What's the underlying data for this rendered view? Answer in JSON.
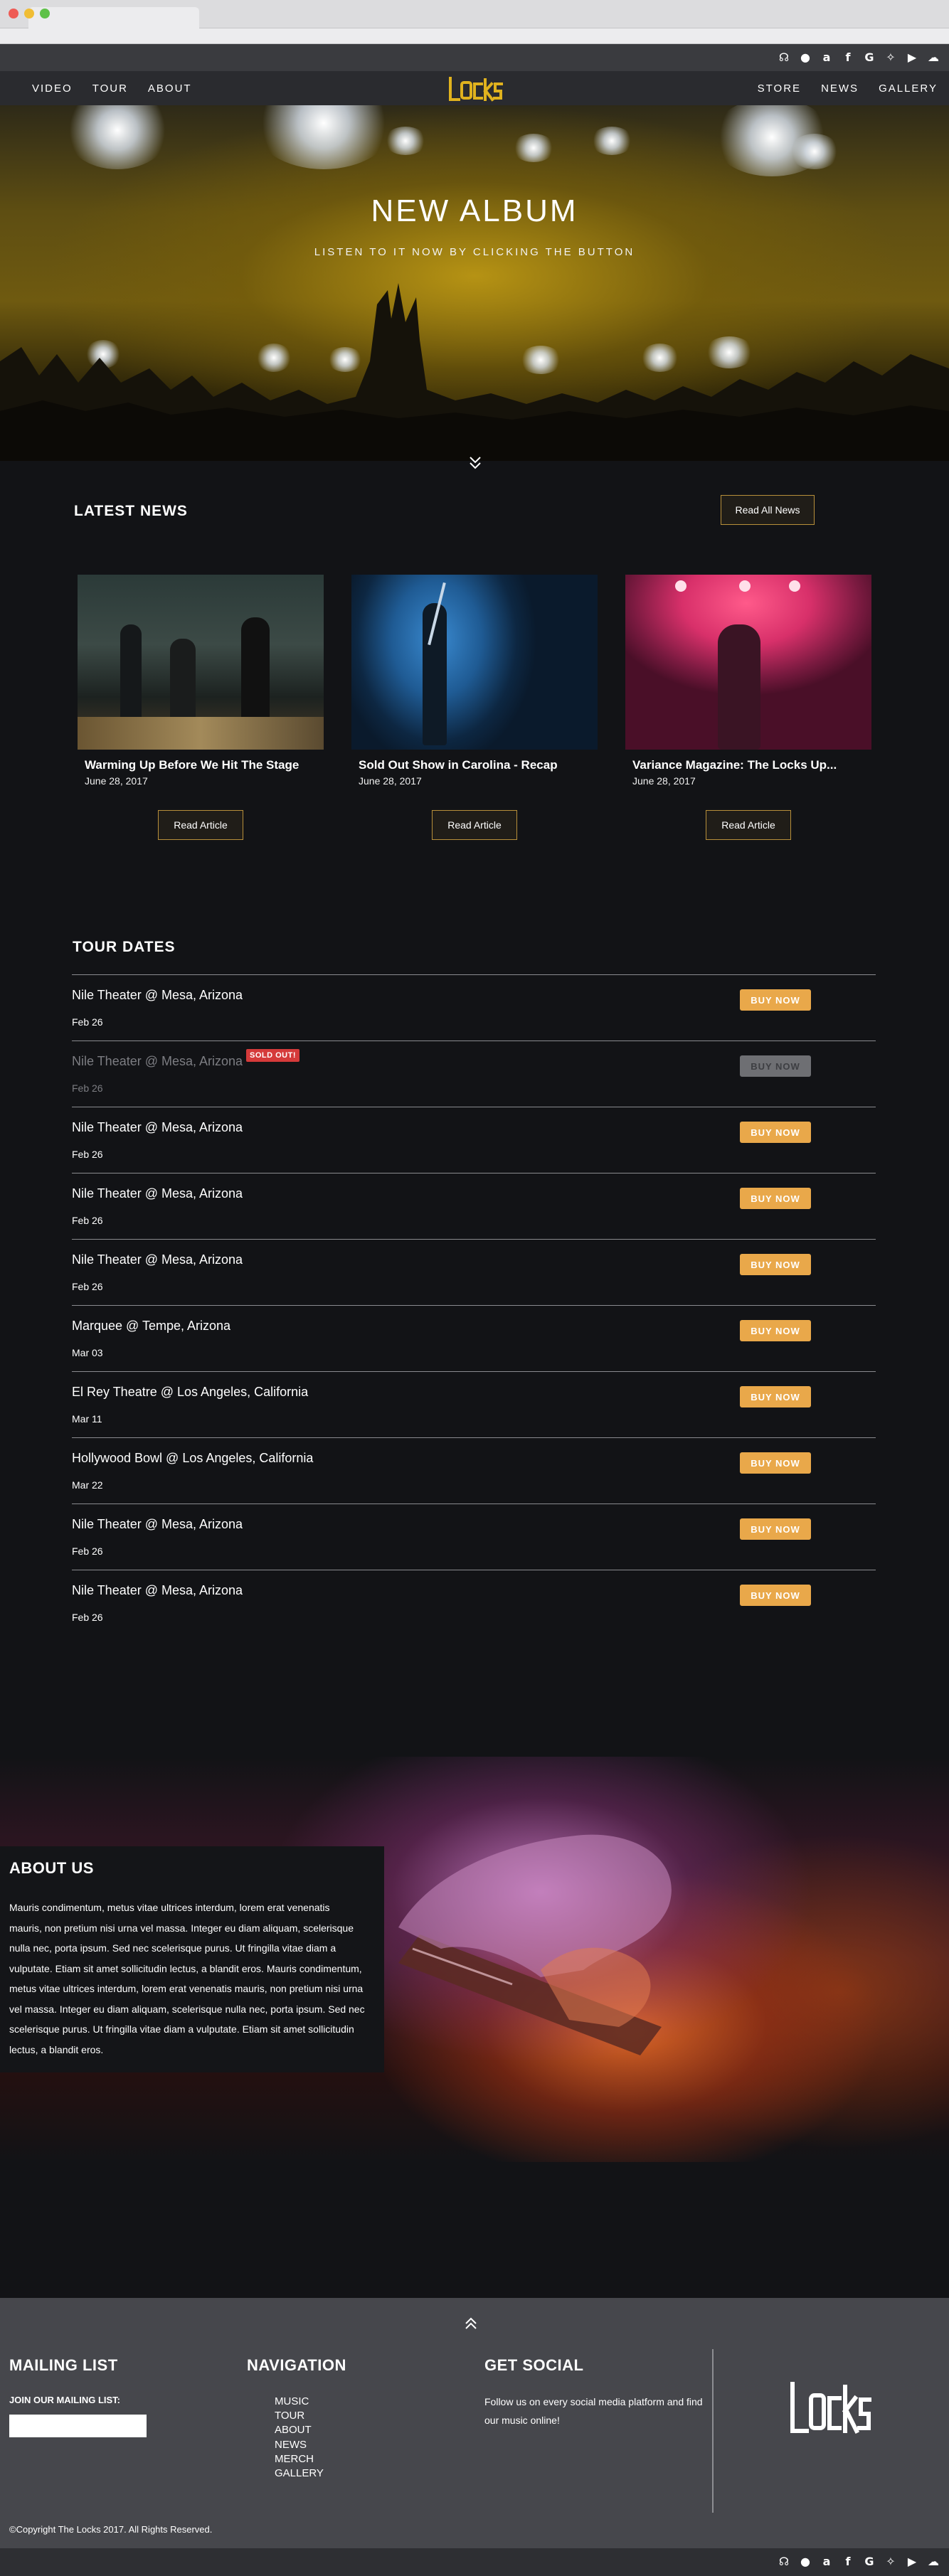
{
  "social_icons": [
    "headphones-icon",
    "apple-icon",
    "amazon-icon",
    "facebook-icon",
    "google-icon",
    "twitter-icon",
    "youtube-icon",
    "soundcloud-icon"
  ],
  "social_glyphs": [
    "☊",
    "●",
    "a",
    "f",
    "G",
    "✧",
    "▶",
    "☁"
  ],
  "nav": {
    "left": [
      "VIDEO",
      "TOUR",
      "ABOUT"
    ],
    "right": [
      "STORE",
      "NEWS",
      "GALLERY"
    ]
  },
  "hero": {
    "title": "NEW ALBUM",
    "subtitle": "LISTEN TO IT NOW BY CLICKING THE BUTTON"
  },
  "news": {
    "title": "LATEST NEWS",
    "read_all_label": "Read All News",
    "read_article_label": "Read Article",
    "articles": [
      {
        "title": "Warming Up Before We Hit The Stage",
        "date": "June 28, 2017"
      },
      {
        "title": "Sold Out Show in Carolina - Recap",
        "date": "June 28, 2017"
      },
      {
        "title": "Variance Magazine: The Locks Up...",
        "date": "June 28, 2017"
      }
    ]
  },
  "tour": {
    "title": "TOUR DATES",
    "buy_label": "BUY NOW",
    "sold_out_label": "SOLD OUT!",
    "dates": [
      {
        "venue": "Nile Theater @ Mesa, Arizona",
        "date": "Feb 26"
      },
      {
        "venue": "Nile Theater @ Mesa, Arizona",
        "date": "Feb 26",
        "sold_out": true
      },
      {
        "venue": "Nile Theater @ Mesa, Arizona",
        "date": "Feb 26"
      },
      {
        "venue": "Nile Theater @ Mesa, Arizona",
        "date": "Feb 26"
      },
      {
        "venue": "Nile Theater @ Mesa, Arizona",
        "date": "Feb 26"
      },
      {
        "venue": "Marquee @ Tempe, Arizona",
        "date": "Mar 03"
      },
      {
        "venue": "El Rey Theatre @ Los Angeles, California",
        "date": "Mar 11"
      },
      {
        "venue": "Hollywood Bowl @ Los Angeles, California",
        "date": "Mar 22"
      },
      {
        "venue": "Nile Theater @ Mesa, Arizona",
        "date": "Feb 26"
      },
      {
        "venue": "Nile Theater @ Mesa, Arizona",
        "date": "Feb 26"
      }
    ]
  },
  "about": {
    "title": "ABOUT US",
    "body": "Mauris condimentum, metus vitae ultrices interdum, lorem erat venenatis mauris, non pretium nisi urna vel massa. Integer eu diam aliquam, scelerisque nulla nec, porta ipsum. Sed nec scelerisque purus. Ut fringilla vitae diam a vulputate. Etiam sit amet sollicitudin lectus, a blandit eros. Mauris condimentum, metus vitae ultrices interdum, lorem erat venenatis mauris, non pretium nisi urna vel massa. Integer eu diam aliquam, scelerisque nulla nec, porta ipsum. Sed nec scelerisque purus. Ut fringilla vitae diam a vulputate. Etiam sit amet sollicitudin lectus, a blandit eros."
  },
  "footer": {
    "mailing_title": "MAILING LIST",
    "mailing_label": "JOIN OUR MAILING LIST:",
    "mailing_placeholder": "",
    "nav_title": "NAVIGATION",
    "nav_items": [
      "MUSIC",
      "TOUR",
      "ABOUT",
      "NEWS",
      "MERCH",
      "GALLERY"
    ],
    "social_title": "GET SOCIAL",
    "social_text": "Follow us on every social media platform and find our music online!",
    "copyright": "©Copyright The Locks 2017. All Rights Reserved."
  },
  "colors": {
    "accent": "#e9a84a",
    "logo_yellow": "#e0b21e",
    "background": "#121316",
    "footer": "#46474c",
    "sold_out": "#d53a3a"
  }
}
